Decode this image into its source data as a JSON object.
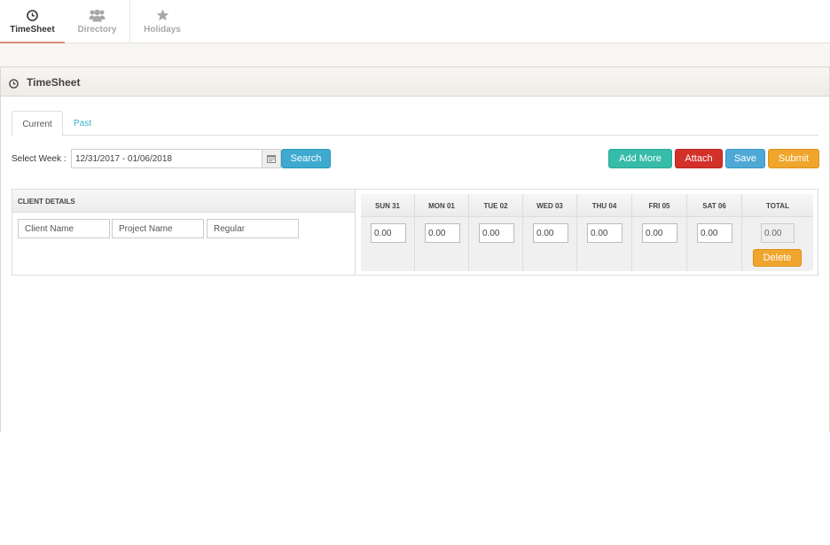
{
  "nav": {
    "tabs": [
      {
        "label": "TimeSheet",
        "icon": "clock-icon",
        "active": true
      },
      {
        "label": "Directory",
        "icon": "users-icon",
        "active": false
      },
      {
        "label": "Holidays",
        "icon": "star-icon",
        "active": false
      }
    ]
  },
  "panel": {
    "title": "TimeSheet",
    "subtabs": {
      "current": "Current",
      "past": "Past"
    }
  },
  "toolbar": {
    "week_label": "Select Week :",
    "week_value": "12/31/2017 - 01/06/2018",
    "search_label": "Search",
    "add_more_label": "Add More",
    "attach_label": "Attach",
    "save_label": "Save",
    "submit_label": "Submit"
  },
  "client": {
    "header": "CLIENT DETAILS",
    "client_name_placeholder": "Client Name",
    "project_name_placeholder": "Project Name",
    "regular_placeholder": "Regular"
  },
  "week": {
    "days": [
      "SUN 31",
      "MON 01",
      "TUE 02",
      "WED 03",
      "THU 04",
      "FRI 05",
      "SAT 06"
    ],
    "total_label": "TOTAL",
    "hours": [
      "0.00",
      "0.00",
      "0.00",
      "0.00",
      "0.00",
      "0.00",
      "0.00"
    ],
    "total_value": "0.00",
    "delete_label": "Delete"
  },
  "colors": {
    "accent_tab": "#e58b7a",
    "search": "#3eaad0",
    "add_more": "#36bca8",
    "attach": "#d3302a",
    "save": "#4fa9d6",
    "submit": "#f0a52c",
    "link": "#3bb0c9"
  }
}
